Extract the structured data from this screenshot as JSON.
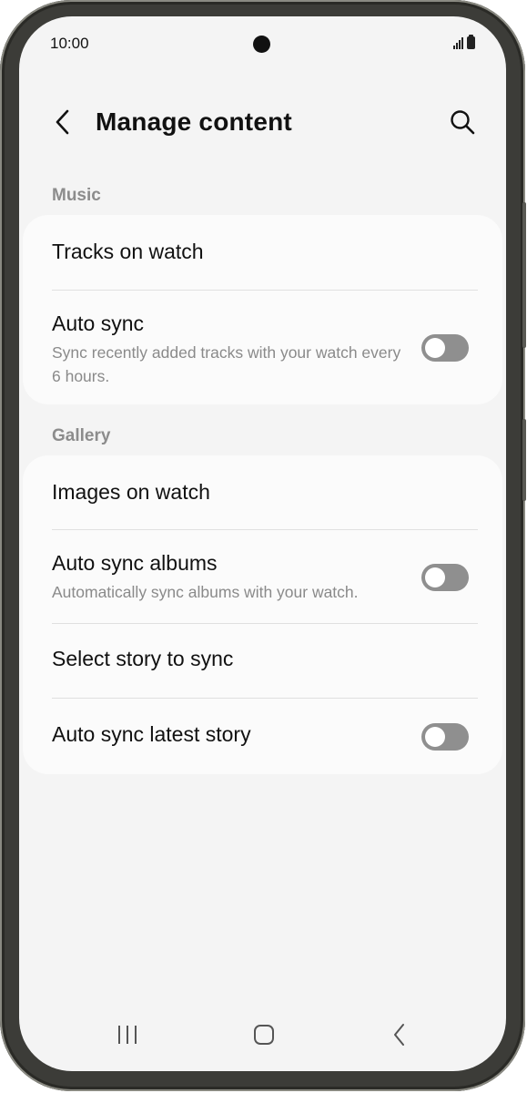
{
  "status_bar": {
    "time": "10:00",
    "icons": [
      "signal-icon",
      "battery-icon"
    ]
  },
  "header": {
    "title": "Manage content",
    "back_icon": "chevron-left-icon",
    "search_icon": "search-icon"
  },
  "sections": {
    "music": {
      "header": "Music",
      "tracks_on_watch": {
        "title": "Tracks on watch"
      },
      "auto_sync": {
        "title": "Auto sync",
        "subtitle": "Sync recently added tracks with your watch every 6 hours.",
        "enabled": false
      }
    },
    "gallery": {
      "header": "Gallery",
      "images_on_watch": {
        "title": "Images on watch"
      },
      "auto_sync_albums": {
        "title": "Auto sync albums",
        "subtitle": "Automatically sync albums with your watch.",
        "enabled": false
      },
      "select_story": {
        "title": "Select story to sync"
      },
      "auto_sync_latest_story": {
        "title": "Auto sync latest story",
        "enabled": false
      }
    }
  },
  "nav_bar": {
    "icons": [
      "recents-icon",
      "home-icon",
      "back-icon"
    ]
  },
  "colors": {
    "background": "#f4f4f4",
    "card": "#fbfbfb",
    "toggle_off": "#8f8f8f",
    "section_header": "#8c8c8c"
  }
}
